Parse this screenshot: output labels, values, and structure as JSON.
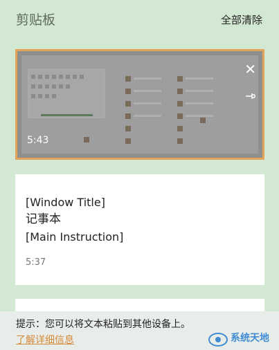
{
  "header": {
    "title": "剪贴板",
    "clear_all": "全部清除"
  },
  "items": [
    {
      "type": "image",
      "time": "5:43"
    },
    {
      "type": "text",
      "lines": [
        "[Window Title]",
        "记事本",
        "[Main Instruction]"
      ],
      "time": "5:37"
    }
  ],
  "footer": {
    "tip": "提示：您可以将文本粘贴到其他设备上。",
    "link": "了解详细信息"
  },
  "watermark": {
    "text": "系统天地"
  },
  "colors": {
    "selection_border": "#e2a35b",
    "link": "#d58a3a",
    "background": "#d3e8d3"
  },
  "icons": {
    "close": "close-icon",
    "pin": "pin-icon"
  }
}
